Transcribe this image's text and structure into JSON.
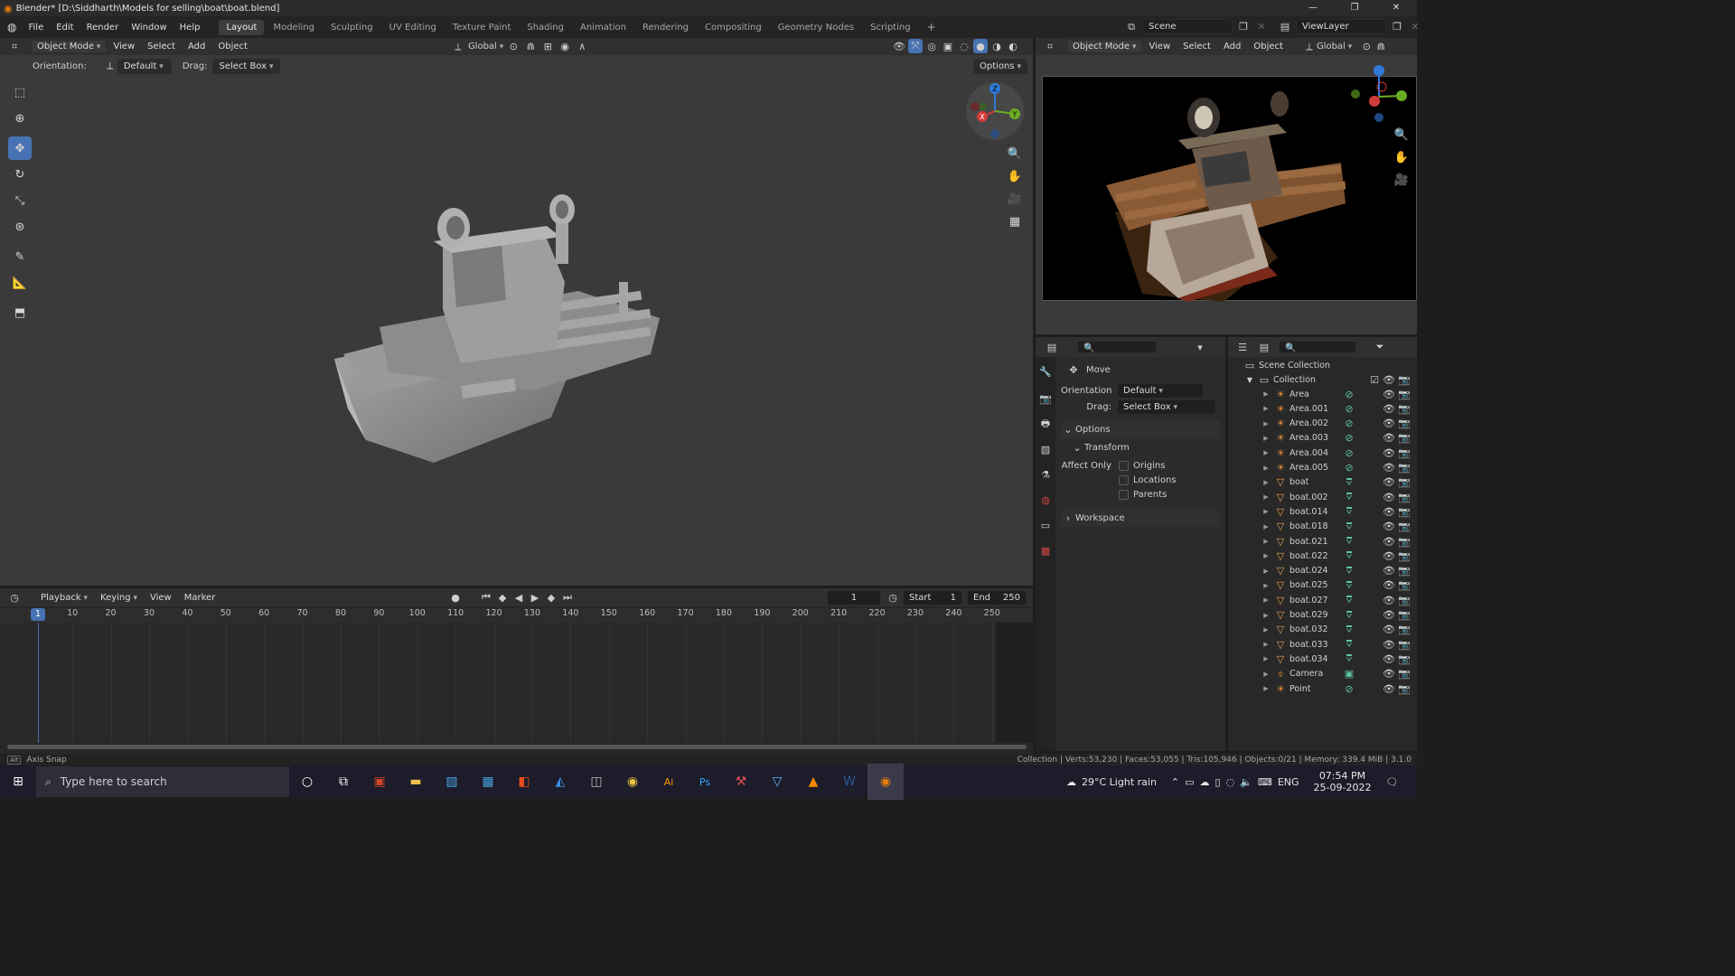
{
  "titlebar": {
    "title": "Blender* [D:\\Siddharth\\Models for selling\\boat\\boat.blend]"
  },
  "menu": [
    "File",
    "Edit",
    "Render",
    "Window",
    "Help"
  ],
  "workspaces": [
    "Layout",
    "Modeling",
    "Sculpting",
    "UV Editing",
    "Texture Paint",
    "Shading",
    "Animation",
    "Rendering",
    "Compositing",
    "Geometry Nodes",
    "Scripting"
  ],
  "active_workspace": "Layout",
  "scene": {
    "label": "Scene",
    "viewlayer": "ViewLayer"
  },
  "viewport_header": {
    "mode": "Object Mode",
    "menus": [
      "View",
      "Select",
      "Add",
      "Object"
    ],
    "transform_orientation": "Global"
  },
  "tool_settings": {
    "orientation_label": "Orientation:",
    "orientation_value": "Default",
    "drag_label": "Drag:",
    "drag_value": "Select Box",
    "options_label": "Options"
  },
  "gizmo": {
    "z": "Z",
    "x": "X",
    "y": "Y"
  },
  "right_header": {
    "mode": "Object Mode",
    "menus": [
      "View",
      "Select",
      "Add",
      "Object"
    ],
    "transform_orientation": "Global"
  },
  "properties": {
    "tool_name": "Move",
    "orientation_label": "Orientation",
    "orientation_value": "Default",
    "drag_label": "Drag:",
    "drag_value": "Select Box",
    "options_header": "Options",
    "transform_header": "Transform",
    "affect_only_label": "Affect Only",
    "checkboxes": [
      "Origins",
      "Locations",
      "Parents"
    ],
    "workspace_header": "Workspace"
  },
  "outliner": {
    "scene_collection": "Scene Collection",
    "collection": "Collection",
    "items": [
      {
        "name": "Area",
        "kind": "light"
      },
      {
        "name": "Area.001",
        "kind": "light"
      },
      {
        "name": "Area.002",
        "kind": "light"
      },
      {
        "name": "Area.003",
        "kind": "light"
      },
      {
        "name": "Area.004",
        "kind": "light"
      },
      {
        "name": "Area.005",
        "kind": "light"
      },
      {
        "name": "boat",
        "kind": "mesh"
      },
      {
        "name": "boat.002",
        "kind": "mesh"
      },
      {
        "name": "boat.014",
        "kind": "mesh"
      },
      {
        "name": "boat.018",
        "kind": "mesh"
      },
      {
        "name": "boat.021",
        "kind": "mesh"
      },
      {
        "name": "boat.022",
        "kind": "mesh"
      },
      {
        "name": "boat.024",
        "kind": "mesh"
      },
      {
        "name": "boat.025",
        "kind": "mesh"
      },
      {
        "name": "boat.027",
        "kind": "mesh"
      },
      {
        "name": "boat.029",
        "kind": "mesh"
      },
      {
        "name": "boat.032",
        "kind": "mesh"
      },
      {
        "name": "boat.033",
        "kind": "mesh"
      },
      {
        "name": "boat.034",
        "kind": "mesh"
      },
      {
        "name": "Camera",
        "kind": "camera"
      },
      {
        "name": "Point",
        "kind": "light"
      }
    ]
  },
  "timeline": {
    "menus": [
      "Playback",
      "Keying",
      "View",
      "Marker"
    ],
    "current_frame": "1",
    "start_label": "Start",
    "start_value": "1",
    "end_label": "End",
    "end_value": "250",
    "ticks": [
      "10",
      "20",
      "30",
      "40",
      "50",
      "60",
      "70",
      "80",
      "90",
      "100",
      "110",
      "120",
      "130",
      "140",
      "150",
      "160",
      "170",
      "180",
      "190",
      "200",
      "210",
      "220",
      "230",
      "240",
      "250"
    ],
    "playhead": "1"
  },
  "statusbar": {
    "left": "Axis Snap",
    "right": "Collection | Verts:53,230 | Faces:53,055 | Tris:105,946 | Objects:0/21 | Memory: 339.4 MiB | 3.1.0"
  },
  "taskbar": {
    "search_placeholder": "Type here to search",
    "weather": "29°C  Light rain",
    "lang": "ENG",
    "time": "07:54 PM",
    "date": "25-09-2022"
  },
  "colors": {
    "accent": "#4772b3",
    "mesh_icon": "#e8a153",
    "light_icon": "#d8893c",
    "data_icon": "#5fc4a2"
  }
}
